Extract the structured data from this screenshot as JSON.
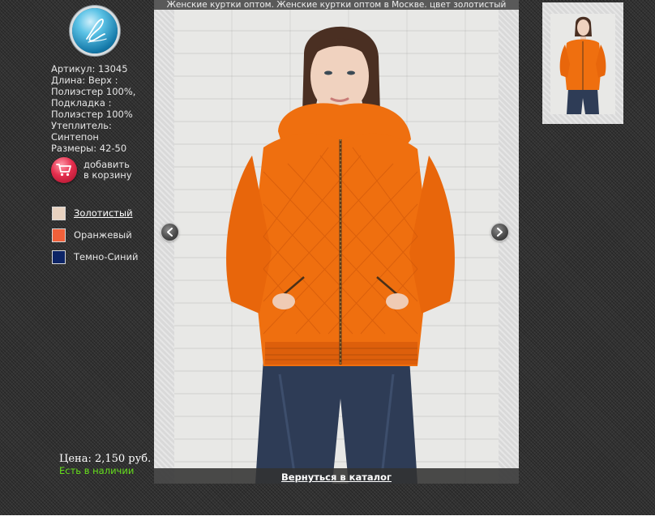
{
  "title": "Женские куртки оптом. Женские куртки оптом в Москве. цвет золотистый",
  "brand": {
    "logo_icon": "signature-logo-icon"
  },
  "product": {
    "specs_lines": [
      "Артикул: 13045",
      "Длина: Верх :",
      "Полиэстер 100%,",
      "Подкладка :",
      "Полиэстер 100%",
      "Утеплитель:",
      "Синтепон",
      "Размеры: 42-50"
    ],
    "price": "Цена: 2,150 руб.",
    "availability": "Есть в наличии"
  },
  "cart": {
    "label_lines": [
      "добавить",
      "в корзину"
    ],
    "icon": "shopping-cart-icon"
  },
  "colors": [
    {
      "label": "Золотистый",
      "swatch": "#e8d2c0",
      "selected": true
    },
    {
      "label": "Оранжевый",
      "swatch": "#f0603a",
      "selected": false
    },
    {
      "label": "Темно-Синий",
      "swatch": "#0d2466",
      "selected": false
    }
  ],
  "gallery": {
    "back_link": "Вернуться в каталог",
    "prev_icon": "chevron-left-icon",
    "next_icon": "chevron-right-icon",
    "jacket_color": "#ef6f0f"
  }
}
